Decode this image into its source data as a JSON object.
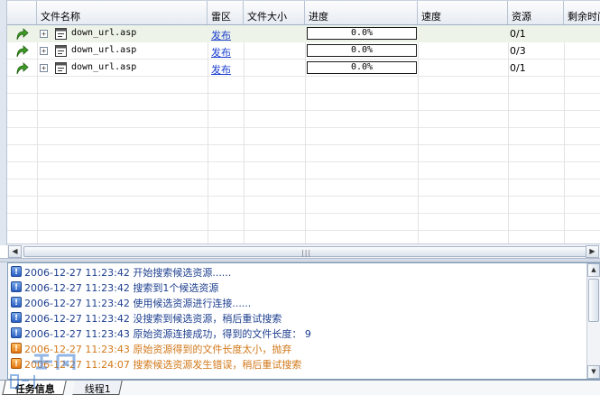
{
  "table": {
    "columns": [
      "文件名称",
      "雷区",
      "文件大小",
      "进度",
      "速度",
      "资源",
      "剩余时间"
    ],
    "rows": [
      {
        "name": "down_url.asp",
        "zone": "发布",
        "size": "",
        "progress": "0.0%",
        "speed": "",
        "sources": "0/1",
        "remaining": ""
      },
      {
        "name": "down_url.asp",
        "zone": "发布",
        "size": "",
        "progress": "0.0%",
        "speed": "",
        "sources": "0/3",
        "remaining": ""
      },
      {
        "name": "down_url.asp",
        "zone": "发布",
        "size": "",
        "progress": "0.0%",
        "speed": "",
        "sources": "0/1",
        "remaining": ""
      }
    ]
  },
  "scrollbar_grip": "|||",
  "log": {
    "entries": [
      {
        "level": "info",
        "text": "2006-12-27 11:23:42 开始搜索候选资源......"
      },
      {
        "level": "info",
        "text": "2006-12-27 11:23:42 搜索到1个候选资源"
      },
      {
        "level": "info",
        "text": "2006-12-27 11:23:42 使用候选资源进行连接......"
      },
      {
        "level": "info",
        "text": "2006-12-27 11:23:42 没搜索到候选资源，稍后重试搜索"
      },
      {
        "level": "info",
        "text": "2006-12-27 11:23:43 原始资源连接成功，得到的文件长度： 9"
      },
      {
        "level": "warn",
        "text": "2006-12-27 11:23:43 原始资源得到的文件长度太小，抛弃"
      },
      {
        "level": "warn",
        "text": "2006-12-27 11:24:07 搜索候选资源发生错误，稍后重试搜索"
      }
    ]
  },
  "tabs": [
    "任务信息",
    "线程1"
  ],
  "colors": {
    "info": "#1d3f8f",
    "warn": "#d2781a",
    "link": "#1a3fd0"
  }
}
